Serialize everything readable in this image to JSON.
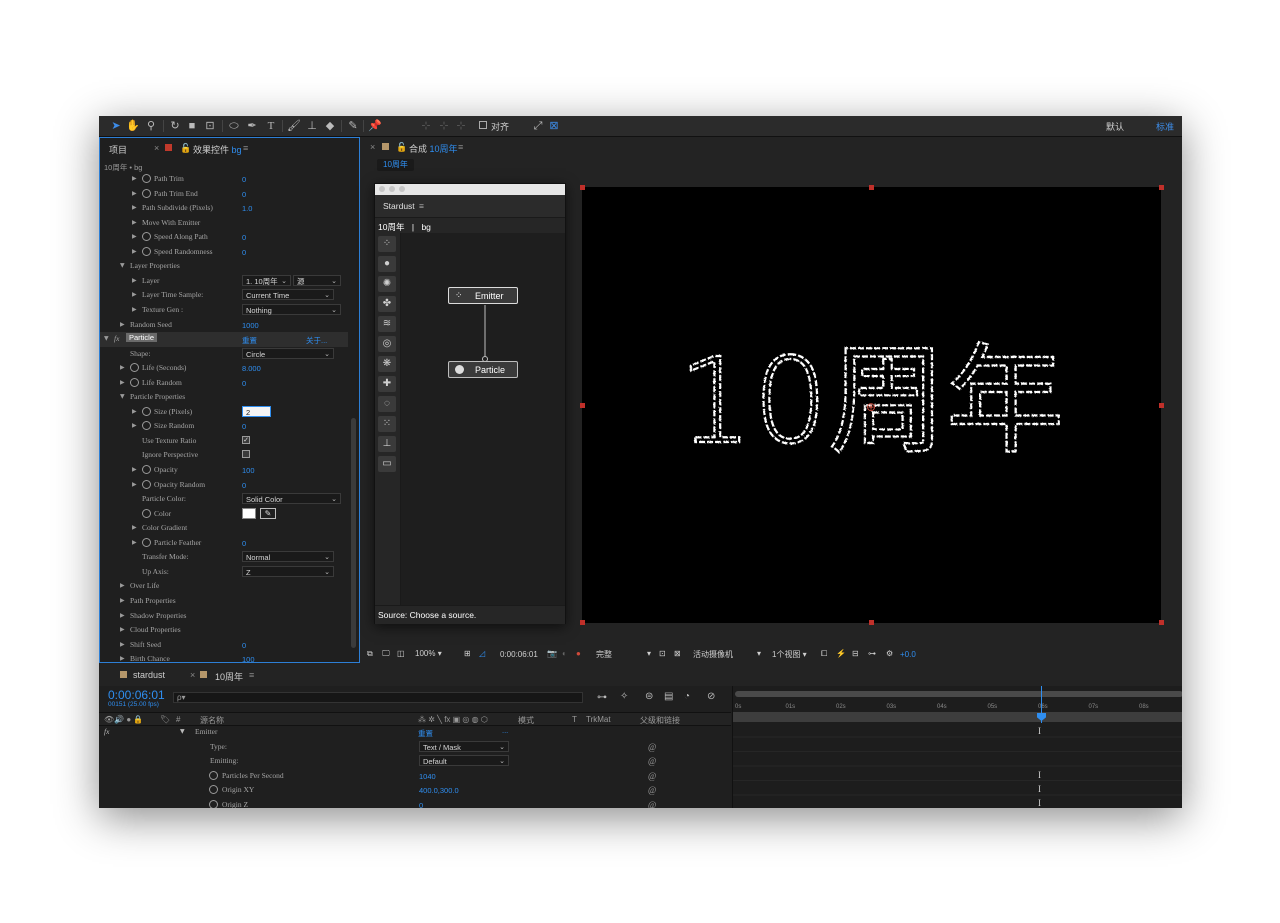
{
  "toolbar": {
    "snap_label": "对齐",
    "workspace_default": "默认",
    "workspace_standard": "标准"
  },
  "left_panel": {
    "tab_project": "项目",
    "tab_effects_prefix": "效果控件",
    "tab_effects_layer": "bg",
    "breadcrumb": "10周年 • bg",
    "rows": [
      {
        "indent": 2,
        "stopwatch": true,
        "label": "Path Trim",
        "value": "0"
      },
      {
        "indent": 2,
        "stopwatch": true,
        "label": "Path Trim End",
        "value": "0"
      },
      {
        "indent": 2,
        "stopwatch": false,
        "label": "Path Subdivide (Pixels)",
        "value": "1.0"
      },
      {
        "indent": 2,
        "stopwatch": false,
        "label": "Move With Emitter",
        "value": ""
      },
      {
        "indent": 2,
        "stopwatch": true,
        "label": "Speed Along Path",
        "value": "0"
      },
      {
        "indent": 2,
        "stopwatch": true,
        "label": "Speed Randomness",
        "value": "0"
      },
      {
        "indent": 1,
        "open": true,
        "label": "Layer Properties",
        "value": ""
      },
      {
        "indent": 2,
        "label": "Layer",
        "value": ""
      },
      {
        "indent": 2,
        "label": "Layer Time Sample:",
        "value": ""
      },
      {
        "indent": 2,
        "label": "Texture Gen :",
        "value": ""
      },
      {
        "indent": 1,
        "label": "Random Seed",
        "value": "1000"
      },
      {
        "indent": 0,
        "fx": true,
        "label": "Particle",
        "value": ""
      },
      {
        "indent": 1,
        "nodisclosure": true,
        "label": "Shape:",
        "value": ""
      },
      {
        "indent": 1,
        "stopwatch": true,
        "label": "Life (Seconds)",
        "value": "8.000"
      },
      {
        "indent": 1,
        "stopwatch": true,
        "label": "Life Random",
        "value": "0"
      },
      {
        "indent": 1,
        "open": true,
        "label": "Particle Properties",
        "value": ""
      },
      {
        "indent": 2,
        "stopwatch": true,
        "label": "Size (Pixels)",
        "value": ""
      },
      {
        "indent": 2,
        "stopwatch": true,
        "label": "Size Random",
        "value": "0"
      },
      {
        "indent": 2,
        "nodisclosure": true,
        "label": "Use Texture Ratio",
        "value": ""
      },
      {
        "indent": 2,
        "nodisclosure": true,
        "label": "Ignore Perspective",
        "value": ""
      },
      {
        "indent": 2,
        "stopwatch": true,
        "label": "Opacity",
        "value": "100"
      },
      {
        "indent": 2,
        "stopwatch": true,
        "label": "Opacity Random",
        "value": "0"
      },
      {
        "indent": 2,
        "nodisclosure": true,
        "label": "Particle Color:",
        "value": ""
      },
      {
        "indent": 2,
        "nodisclosure": true,
        "stopwatch": true,
        "label": "Color",
        "value": ""
      },
      {
        "indent": 2,
        "label": "Color Gradient",
        "value": ""
      },
      {
        "indent": 2,
        "stopwatch": true,
        "label": "Particle Feather",
        "value": "0"
      },
      {
        "indent": 2,
        "nodisclosure": true,
        "label": "Transfer Mode:",
        "value": ""
      },
      {
        "indent": 2,
        "nodisclosure": true,
        "label": "Up Axis:",
        "value": ""
      },
      {
        "indent": 1,
        "label": "Over Life",
        "value": ""
      },
      {
        "indent": 1,
        "label": "Path Properties",
        "value": ""
      },
      {
        "indent": 1,
        "label": "Shadow Properties",
        "value": ""
      },
      {
        "indent": 1,
        "label": "Cloud Properties",
        "value": ""
      },
      {
        "indent": 1,
        "label": "Shift Seed",
        "value": "0"
      },
      {
        "indent": 1,
        "label": "Birth Chance",
        "value": "100"
      }
    ],
    "layer_select": "1. 10周年",
    "layer_source_select": "源",
    "layer_time_sample_select": "Current Time",
    "texture_gen_select": "Nothing",
    "particle_reset": "重置",
    "particle_about": "关于...",
    "shape_select": "Circle",
    "size_value": "2",
    "particle_color_select": "Solid Color",
    "transfer_mode_select": "Normal",
    "up_axis_select": "Z"
  },
  "composition": {
    "tab_prefix": "合成",
    "tab_name": "10周年",
    "sub_tab": "10周年",
    "artwork_text": "10周年",
    "footer": {
      "zoom": "100%",
      "timecode": "0:00:06:01",
      "resolution": "完整",
      "camera": "活动摄像机",
      "views": "1个视图",
      "exposure": "+0.0"
    }
  },
  "stardust": {
    "title": "Stardust",
    "breadcrumb_comp": "10周年",
    "breadcrumb_sep": "|",
    "breadcrumb_layer": "bg",
    "node_emitter": "Emitter",
    "node_particle": "Particle",
    "status": "Source: Choose a source."
  },
  "timeline": {
    "tab_render": "stardust",
    "tab_comp": "10周年",
    "timecode": "0:00:06:01",
    "frame_info": "00151 (25.00 fps)",
    "search_placeholder": "ρ▾",
    "col_source_name": "源名称",
    "col_mode": "模式",
    "col_t": "T",
    "col_trkmat": "TrkMat",
    "col_parent": "父级和链接",
    "ruler_ticks": [
      "0s",
      "01s",
      "02s",
      "03s",
      "04s",
      "05s",
      "06s",
      "07s",
      "08s"
    ],
    "layers": [
      {
        "name": "Emitter",
        "kind": "group",
        "value": "重置",
        "extra": "..."
      },
      {
        "name": "Type:",
        "kind": "dropdown",
        "value": "Text / Mask"
      },
      {
        "name": "Emitting:",
        "kind": "dropdown",
        "value": "Default"
      },
      {
        "name": "Particles Per Second",
        "kind": "value",
        "value": "1040"
      },
      {
        "name": "Origin XY",
        "kind": "value",
        "value": "400.0,300.0"
      },
      {
        "name": "Origin Z",
        "kind": "value",
        "value": "0"
      }
    ]
  },
  "colors": {
    "accent": "#2f8ef0",
    "handle": "#c0302a",
    "keyframe": "#38c24a"
  }
}
